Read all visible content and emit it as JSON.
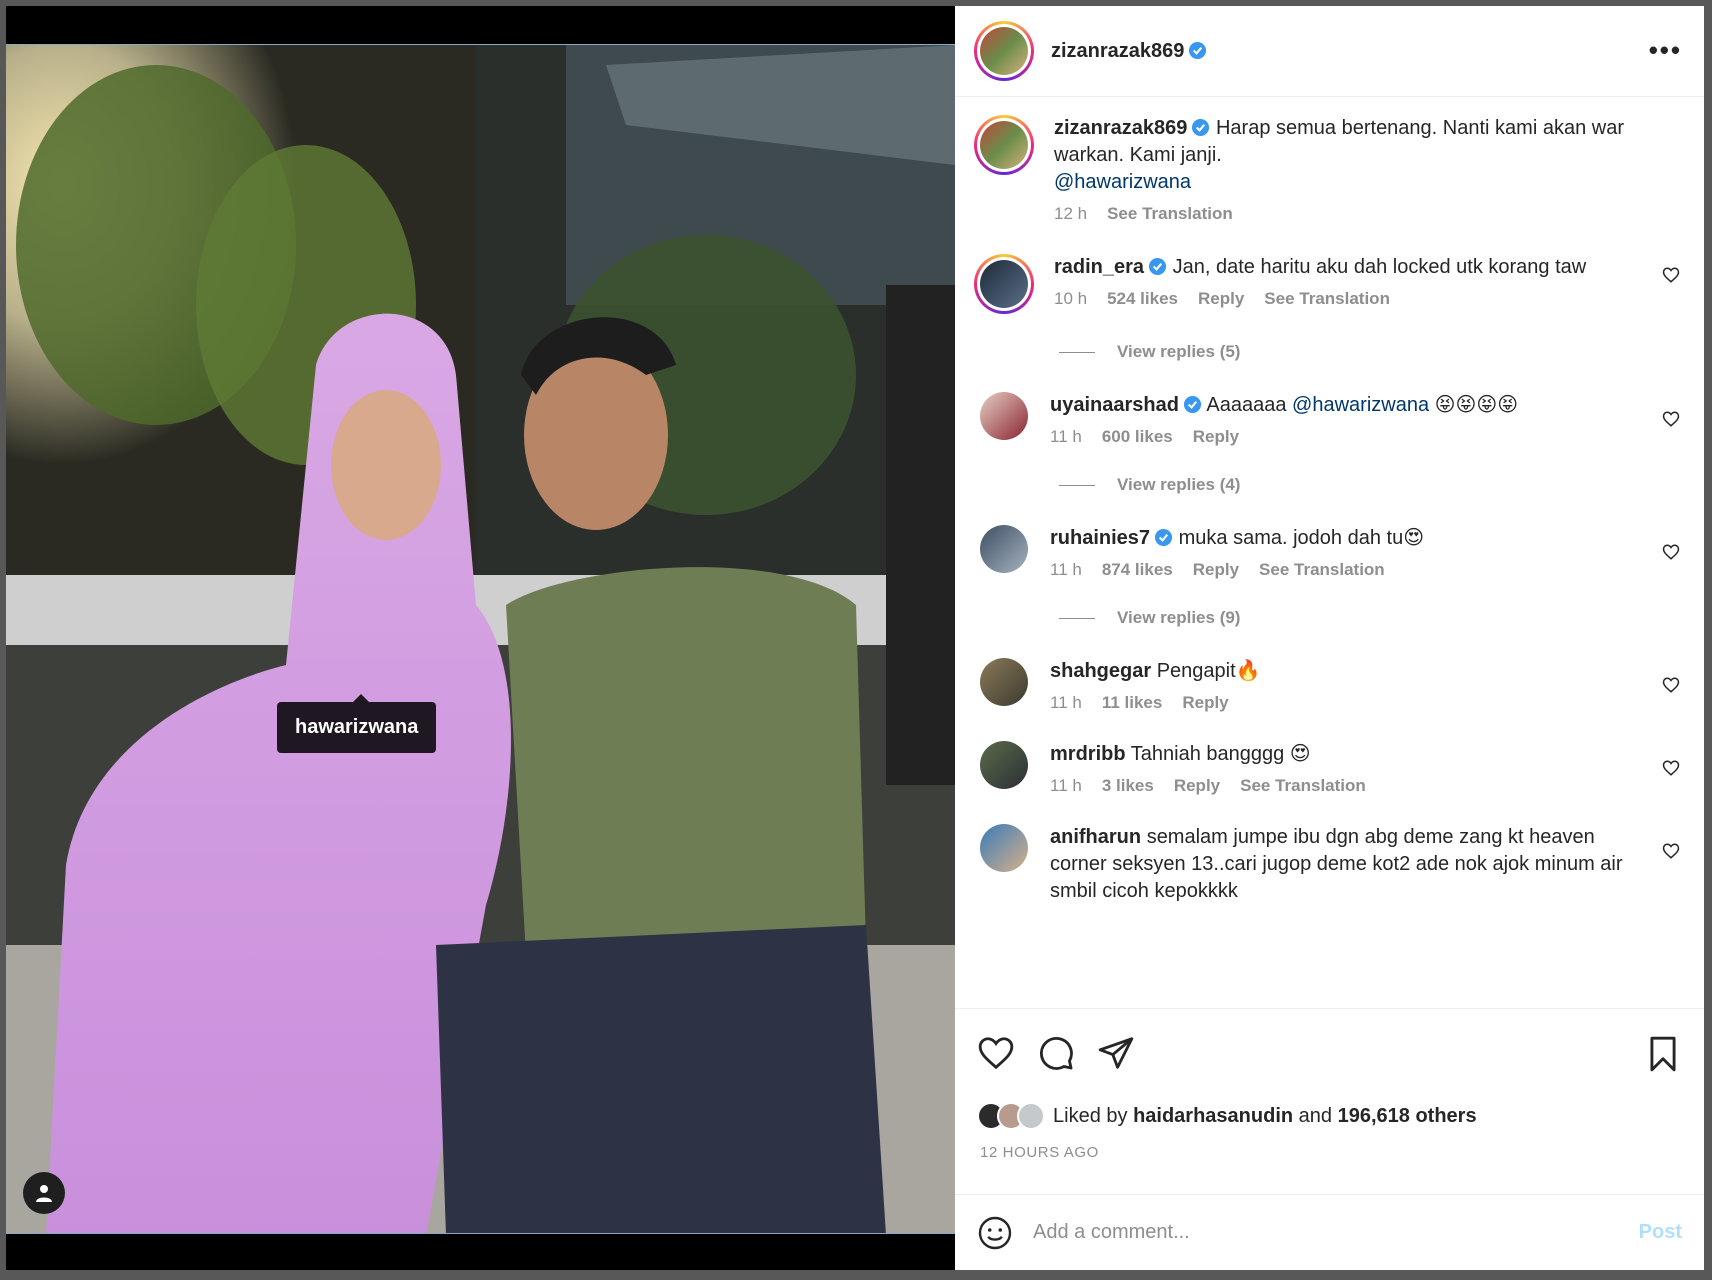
{
  "post": {
    "author": "zizanrazak869",
    "caption": "Harap semua bertenang. Nanti kami akan war warkan. Kami janji.",
    "caption_mention": "@hawarizwana",
    "time": "12 h",
    "see_translation": "See Translation",
    "photo_tag": "hawarizwana"
  },
  "comments": [
    {
      "user": "radin_era",
      "verified": true,
      "text": "Jan, date haritu aku dah locked utk korang taw",
      "time": "10 h",
      "likes": "524 likes",
      "reply": "Reply",
      "translation": "See Translation",
      "replies": "View replies (5)"
    },
    {
      "user": "uyainaarshad",
      "verified": true,
      "text": "Aaaaaaa",
      "mention": "@hawarizwana",
      "emoji": "😝😝😝😝",
      "time": "11 h",
      "likes": "600 likes",
      "reply": "Reply",
      "replies": "View replies (4)"
    },
    {
      "user": "ruhainies7",
      "verified": true,
      "text": "muka sama. jodoh dah tu😍",
      "time": "11 h",
      "likes": "874 likes",
      "reply": "Reply",
      "translation": "See Translation",
      "replies": "View replies (9)"
    },
    {
      "user": "shahgegar",
      "verified": false,
      "text": "Pengapit🔥",
      "time": "11 h",
      "likes": "11 likes",
      "reply": "Reply"
    },
    {
      "user": "mrdribb",
      "verified": false,
      "text": "Tahniah bangggg 😍",
      "time": "11 h",
      "likes": "3 likes",
      "reply": "Reply",
      "translation": "See Translation"
    },
    {
      "user": "anifharun",
      "verified": false,
      "text": "semalam jumpe ibu dgn abg deme zang kt heaven corner seksyen 13..cari jugop deme kot2 ade nok ajok minum air smbil cicoh kepokkkk"
    }
  ],
  "likes_line": {
    "prefix": "Liked by",
    "user": "haidarhasanudin",
    "and": "and",
    "others": "196,618 others"
  },
  "timestamp": "12 HOURS AGO",
  "add_comment": {
    "placeholder": "Add a comment...",
    "post_label": "Post"
  },
  "colors": {
    "link": "#00376b",
    "verified": "#3897f0",
    "post_disabled": "#b2dffc"
  }
}
